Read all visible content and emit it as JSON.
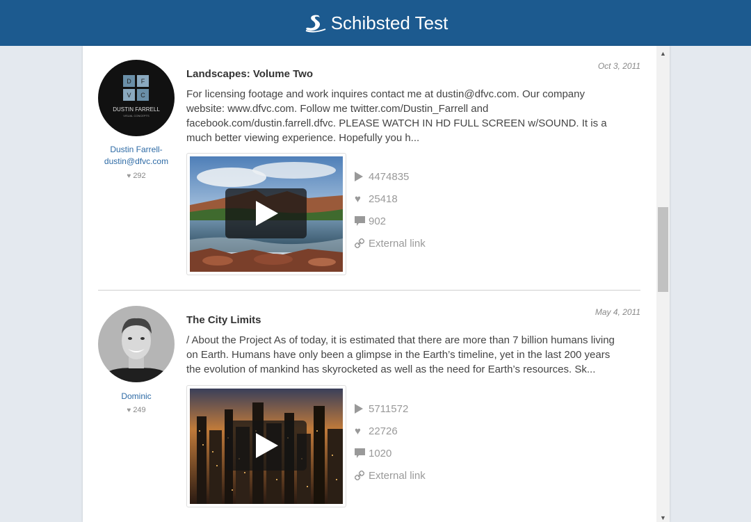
{
  "header": {
    "title": "Schibsted Test",
    "color": "#1c5a8f"
  },
  "entries": [
    {
      "title": "Landscapes: Volume Two",
      "date": "Oct 3, 2011",
      "description": "For licensing footage and work inquires contact me at dustin@dfvc.com. Our company website: www.dfvc.com. Follow me twitter.com/Dustin_Farrell and facebook.com/dustin.farrell.dfvc. PLEASE WATCH IN HD FULL SCREEN w/SOUND. It is a much better viewing experience. Hopefully you h...",
      "author_name": "Dustin Farrell-",
      "author_email": "dustin@dfvc.com",
      "author_likes": "292",
      "logo_letters": [
        "D",
        "F",
        "V",
        "C"
      ],
      "logo_name": "DUSTIN FARRELL",
      "logo_tagline": "VISUAL CONCEPTS",
      "plays": "4474835",
      "likes": "25418",
      "comments": "902",
      "link_label": "External link"
    },
    {
      "title": "The City Limits",
      "date": "May 4, 2011",
      "description": "/ About the Project As of today, it is estimated that there are more than 7 billion humans living on Earth. Humans have only been a glimpse in the Earth’s timeline, yet in the last 200 years the evolution of mankind has skyrocketed as well as the need for Earth’s resources. Sk...",
      "author_name": "Dominic",
      "author_likes": "249",
      "plays": "5711572",
      "likes": "22726",
      "comments": "1020",
      "link_label": "External link"
    }
  ]
}
